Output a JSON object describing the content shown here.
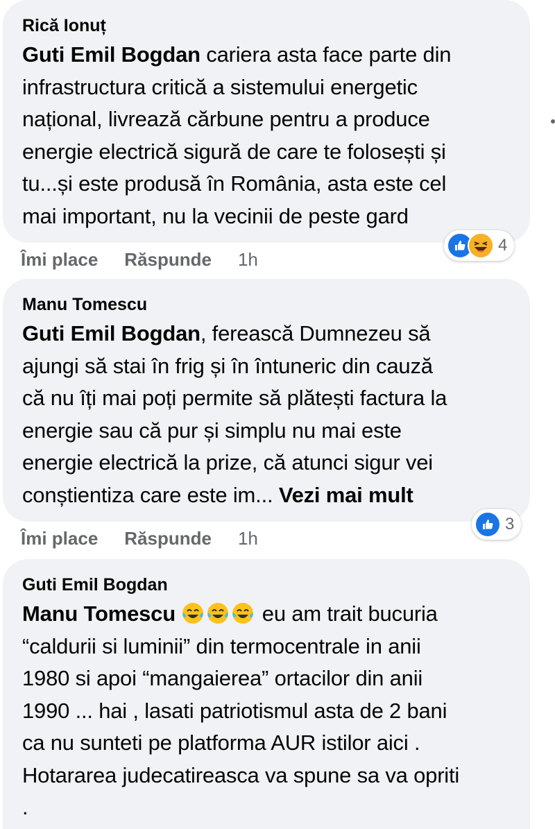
{
  "comments": [
    {
      "author": "Rică Ionuț",
      "mention": "Guti Emil Bogdan",
      "lines": [
        " cariera asta face parte din",
        "infrastructura critică a sistemului energetic",
        "național, livrează cărbune pentru a produce",
        "energie electrică sigură de care te folosești și",
        "tu...și este produsă în România, asta este cel",
        "mai important, nu la vecinii de peste gard"
      ],
      "like_label": "Îmi place",
      "reply_label": "Răspunde",
      "time": "1h",
      "reaction_count": "4",
      "reactions": [
        "like-icon",
        "haha-icon"
      ]
    },
    {
      "author": "Manu Tomescu",
      "mention": "Guti Emil Bogdan",
      "lines": [
        ", ferească Dumnezeu să",
        "ajungi să stai în frig și în întuneric din cauză",
        "că nu îți mai poți permite să plătești factura la",
        "energie sau că pur și simplu nu mai este",
        "energie electrică la prize, că atunci sigur vei",
        "conștientiza care este im... "
      ],
      "see_more": "Vezi mai mult",
      "like_label": "Îmi place",
      "reply_label": "Răspunde",
      "time": "1h",
      "reaction_count": "3",
      "reactions": [
        "like-icon"
      ]
    },
    {
      "author": "Guti Emil Bogdan",
      "mention": "Manu Tomescu",
      "emojis": [
        "tears-of-joy-emoji",
        "tears-of-joy-emoji",
        "tears-of-joy-emoji"
      ],
      "lines": [
        " eu am trait bucuria",
        "“caldurii si luminii” din termocentrale in anii",
        "1980 si apoi “mangaierea” ortacilor din anii",
        "1990 ... hai , lasati patriotismul asta de 2 bani",
        "ca nu sunteti pe platforma AUR istilor aici .",
        "Hotararea judecatireasca va spune sa va opriti",
        "."
      ]
    }
  ],
  "colors": {
    "bubble": "#f0f2f5",
    "text": "#050505",
    "muted": "#65676b",
    "like": "#1b74e4",
    "haha": "#f7b125"
  }
}
